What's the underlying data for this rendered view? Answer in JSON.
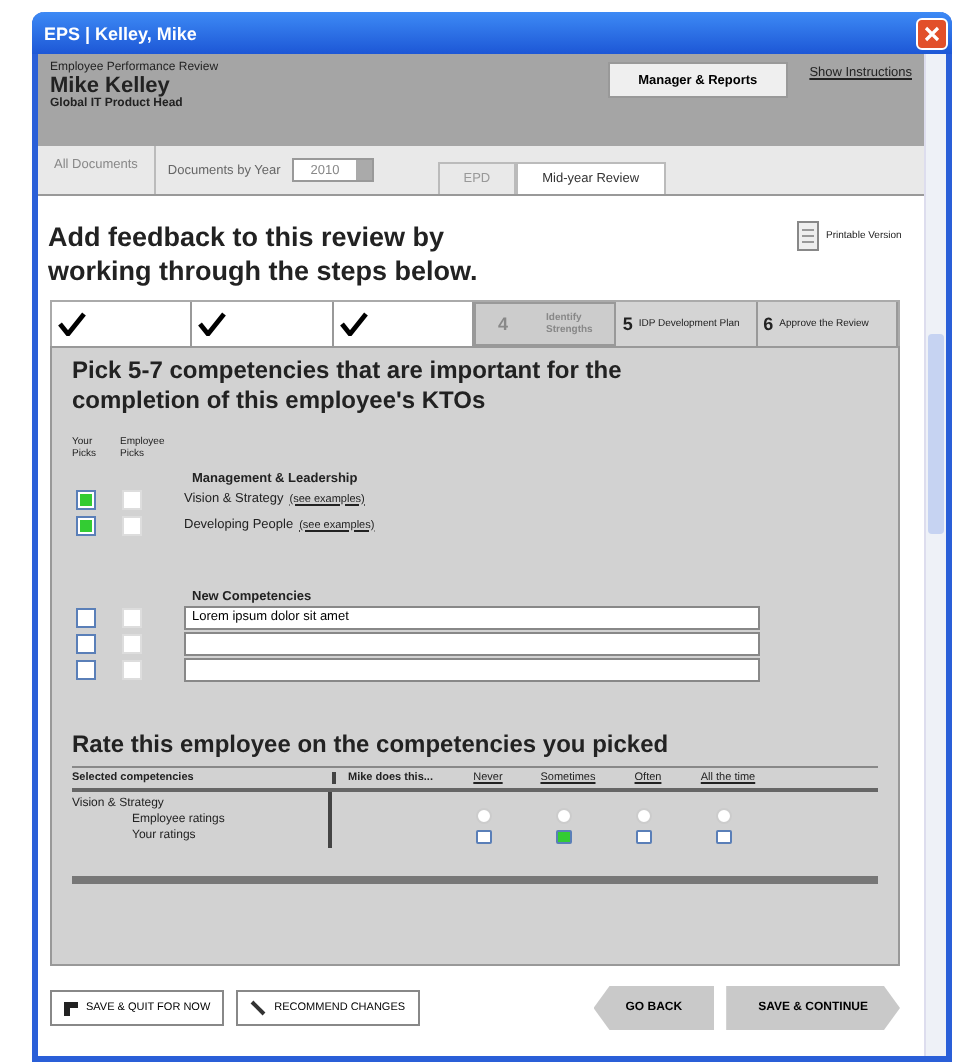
{
  "window": {
    "title": "EPS | Kelley, Mike"
  },
  "header": {
    "caption": "Employee Performance Review",
    "name": "Mike Kelley",
    "role": "Global IT Product Head",
    "menu": "Manager & Reports",
    "instructions": "Show Instructions"
  },
  "nav": {
    "all_documents": "All Documents",
    "by_year": "Documents by Year",
    "year": "2010",
    "tabs": [
      {
        "label": "EPD",
        "selected": false
      },
      {
        "label": "Mid-year Review",
        "selected": true
      }
    ]
  },
  "intro": "Add feedback to this review by working through the steps below.",
  "printable": "Printable Version",
  "steps": [
    {
      "done": true,
      "selected": false
    },
    {
      "done": true,
      "selected": false
    },
    {
      "done": true,
      "selected": false
    },
    {
      "number": "4",
      "label": "Identify Strengths",
      "done": false,
      "selected": true
    },
    {
      "number": "5",
      "label": "IDP Development Plan",
      "done": false,
      "selected": false
    },
    {
      "number": "6",
      "label": "Approve the Review",
      "done": false,
      "selected": false
    }
  ],
  "pick": {
    "heading": "Pick 5-7 competencies that are important for the completion of this employee's KTOs",
    "your_picks": "Your Picks",
    "employee_picks": "Employee Picks",
    "group": {
      "title": "Management & Leadership",
      "items": [
        {
          "label": "Vision & Strategy",
          "link": "(see examples)",
          "yours": true,
          "employee": false
        },
        {
          "label": "Developing People",
          "link": "(see examples)",
          "yours": true,
          "employee": false
        }
      ]
    },
    "new": {
      "title": "New Competencies",
      "rows": [
        {
          "value": "Lorem ipsum dolor sit amet",
          "yours": false,
          "employee": false
        },
        {
          "value": "",
          "yours": false,
          "employee": false
        },
        {
          "value": "",
          "yours": false,
          "employee": false
        }
      ]
    }
  },
  "rate": {
    "heading": "Rate this employee on the competencies you picked",
    "col_competency": "Selected competencies",
    "col_does": "Mike does this...",
    "options": [
      {
        "label": "Never",
        "employee": false,
        "yours": false
      },
      {
        "label": "Sometimes",
        "employee": false,
        "yours": true
      },
      {
        "label": "Often",
        "employee": false,
        "yours": false
      },
      {
        "label": "All the time",
        "employee": false,
        "yours": false
      }
    ],
    "competency": "Vision & Strategy",
    "employee_ratings": "Employee ratings",
    "your_ratings": "Your ratings"
  },
  "buttons": {
    "save_quit": "SAVE & QUIT FOR NOW",
    "recommend": "RECOMMEND CHANGES",
    "back": "GO BACK",
    "continue": "SAVE & CONTINUE"
  }
}
